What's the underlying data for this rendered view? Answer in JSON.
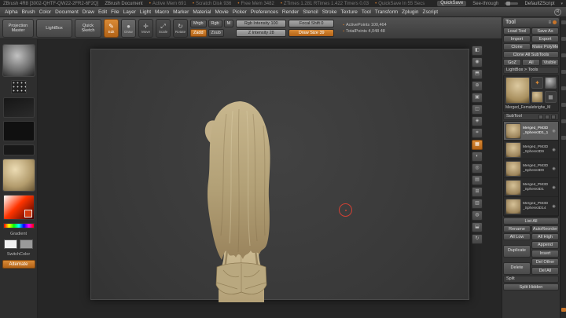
{
  "colors": {
    "accent_orange": "#c9752a",
    "clay": "#c2b087",
    "canvas_bg": "#3b3b3b"
  },
  "titlebar": {
    "title": "ZBrush 4R8 [3002-QHTF-QW22-2FR2-6F2Q]",
    "document": "ZBrush Document",
    "stats": [
      "Active Mem 691",
      "Scratch Disk 936",
      "Free Mem 3482",
      "ZTimes 1.281  RTimes 1.422  Timers 0.03",
      "QuickSave In 55 Secs"
    ],
    "quicksave": "QuickSave",
    "see_through": "See-through",
    "script": "DefaultZScript",
    "chevron": "▾"
  },
  "menubar": {
    "items": [
      "Alpha",
      "Brush",
      "Color",
      "Document",
      "Draw",
      "Edit",
      "File",
      "Layer",
      "Light",
      "Macro",
      "Marker",
      "Material",
      "Movie",
      "Picker",
      "Preferences",
      "Render",
      "Stencil",
      "Stroke",
      "Texture",
      "Tool",
      "Transform",
      "Zplugin",
      "Zscript"
    ],
    "logo": "R"
  },
  "toolbar": {
    "projection_master": "Projection Master",
    "lightbox": "LightBox",
    "quick_sketch": "Quick Sketch",
    "modes": {
      "edit": "Edit",
      "draw": "Draw",
      "move": "Move",
      "scale": "Scale",
      "rotate": "Rotate"
    },
    "mrgb": "Mrgb",
    "rgb": "Rgb",
    "m": "M",
    "rgb_intensity": "Rgb Intensity 100",
    "zadd": "Zadd",
    "zsub": "Zsub",
    "z_intensity": "Z Intensity 28",
    "focal_shift": "Focal Shift 0",
    "draw_size": "Draw Size 39",
    "active_points": "ActivePoints 100,464",
    "total_points": "TotalPoints 4,048 48"
  },
  "left_shelf": {
    "gradient": "Gradient",
    "switch_color": "SwitchColor",
    "alternate": "Alternate"
  },
  "tool_panel": {
    "title": "Tool",
    "load_tool": "Load Tool",
    "save_as": "Save As",
    "import": "Import",
    "export": "Export",
    "clone": "Clone",
    "make_polymesh": "Make PolyMesh3D",
    "clone_all": "Clone All SubTools",
    "goz": "GoZ",
    "all": "All",
    "visible": "Visible",
    "lightbox_tools": "LightBox > Tools",
    "active_tool_name": "Merged_Femalebrighe_M",
    "subtool": {
      "title": "SubTool",
      "items": [
        {
          "name": "Merged_PM3D_Sphere3D1_1",
          "selected": true
        },
        {
          "name": "Merged_PM3D_Sphere3D9",
          "selected": false
        },
        {
          "name": "Merged_PM3D_Sphere3D9",
          "selected": false
        },
        {
          "name": "Merged_PM3D_Sphere3D1",
          "selected": false
        },
        {
          "name": "Merged_PM3D_Sphere3D14",
          "selected": false
        }
      ],
      "list_all": "List All",
      "rename": "Rename",
      "autoreorder": "AutoReorder",
      "all_low": "All Low",
      "all_high": "All High",
      "append": "Append",
      "insert": "Insert",
      "duplicate": "Duplicate",
      "delete": "Delete",
      "del_other": "Del Other",
      "del_all": "Del All"
    },
    "split": {
      "title": "Split",
      "split_hidden": "Split Hidden"
    }
  }
}
